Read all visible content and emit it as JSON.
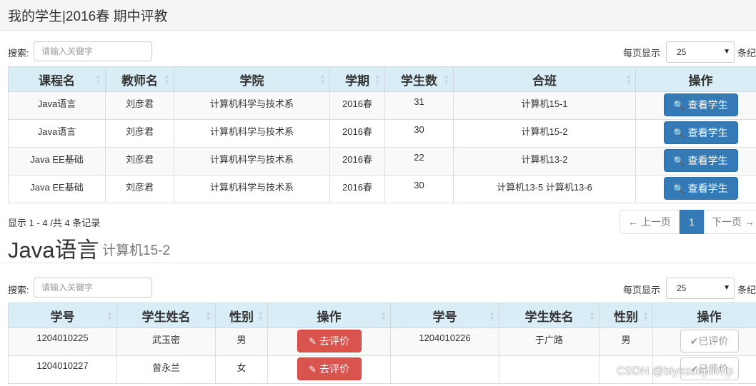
{
  "header": {
    "title": "我的学生|2016春 期中评教"
  },
  "courses_panel": {
    "search_label": "搜索:",
    "search_placeholder": "请输入关键字",
    "page_size_label": "每页显示",
    "page_size_value": "25",
    "page_size_suffix": "条纪",
    "columns": [
      "课程名",
      "教师名",
      "学院",
      "学期",
      "学生数",
      "合班",
      "操作"
    ],
    "rows": [
      {
        "course": "Java语言",
        "teacher": "刘彦君",
        "college": "计算机科学与技术系",
        "term": "2016春",
        "count": "31",
        "class": "计算机15-1",
        "action": "查看学生"
      },
      {
        "course": "Java语言",
        "teacher": "刘彦君",
        "college": "计算机科学与技术系",
        "term": "2016春",
        "count": "30",
        "class": "计算机15-2",
        "action": "查看学生"
      },
      {
        "course": "Java EE基础",
        "teacher": "刘彦君",
        "college": "计算机科学与技术系",
        "term": "2016春",
        "count": "22",
        "class": "计算机13-2",
        "action": "查看学生"
      },
      {
        "course": "Java EE基础",
        "teacher": "刘彦君",
        "college": "计算机科学与技术系",
        "term": "2016春",
        "count": "30",
        "class": "计算机13-5 计算机13-6",
        "action": "查看学生"
      }
    ],
    "record_info": "显示 1 - 4 /共 4 条记录",
    "pager": {
      "prev": "← 上一页",
      "current": "1",
      "next": "下一页 →"
    }
  },
  "students_panel": {
    "course_title": "Java语言",
    "class_subtitle": "计算机15-2",
    "search_label": "搜索:",
    "search_placeholder": "请输入关键字",
    "page_size_label": "每页显示",
    "page_size_value": "25",
    "page_size_suffix": "条纪",
    "columns": [
      "学号",
      "学生姓名",
      "性别",
      "操作",
      "学号",
      "学生姓名",
      "性别",
      "操作"
    ],
    "rows": [
      {
        "id1": "1204010225",
        "name1": "武玉密",
        "sex1": "男",
        "action1": "去评价",
        "id2": "1204010226",
        "name2": "于广路",
        "sex2": "男",
        "action2": "✔已评价"
      },
      {
        "id1": "1204010227",
        "name1": "曾永兰",
        "sex1": "女",
        "action1": "去评价",
        "id2": "",
        "name2": "",
        "sex2": "",
        "action2": "✔已评价"
      }
    ]
  },
  "watermark": "CSDN @biyezuopinvip",
  "colors": {
    "header_bg": "#f5f5f5",
    "table_head_bg": "#d9edf7",
    "primary": "#337ab7",
    "danger": "#d9534f"
  },
  "icons": {
    "view": "zoom-icon",
    "eval": "edit-icon",
    "done": "check-icon",
    "select": "caret-down-icon"
  }
}
